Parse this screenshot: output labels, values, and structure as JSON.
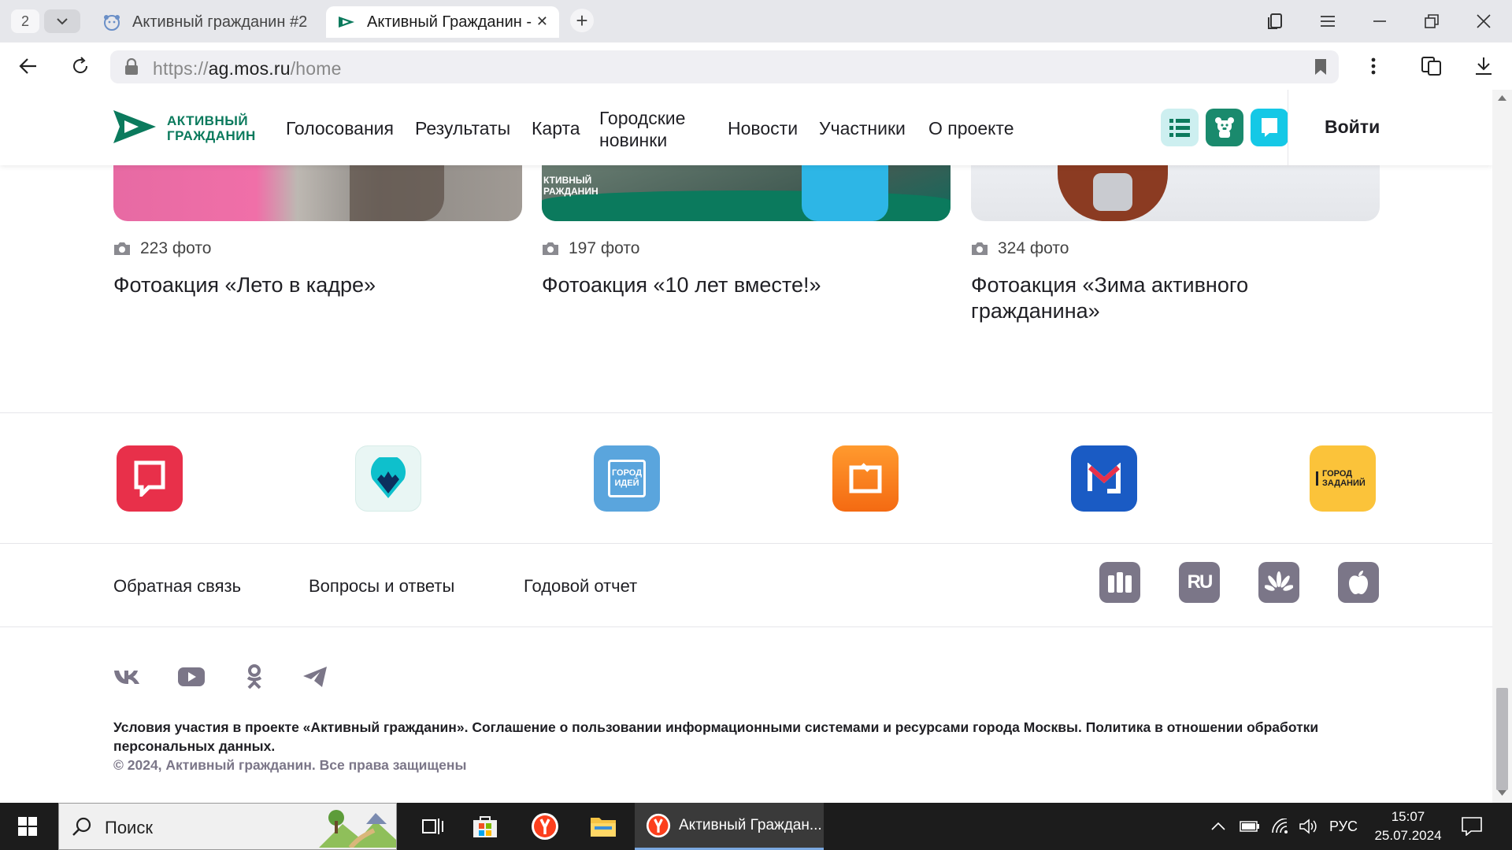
{
  "browser": {
    "tab_count": "2",
    "tabs": [
      {
        "title": "Активный гражданин #2"
      },
      {
        "title": "Активный Гражданин -"
      }
    ],
    "url_scheme": "https://",
    "url_host": "ag.mos.ru",
    "url_path": "/home"
  },
  "header": {
    "logo_line1": "АКТИВНЫЙ",
    "logo_line2": "ГРАЖДАНИН",
    "nav": [
      "Голосования",
      "Результаты",
      "Карта",
      "Городские новинки",
      "Новости",
      "Участники",
      "О проекте"
    ],
    "login": "Войти"
  },
  "photo_cards": [
    {
      "count": "223 фото",
      "title": "Фотоакция «Лето в кадре»"
    },
    {
      "count": "197 фото",
      "title": "Фотоакция «10 лет вместе!»",
      "overlay_line1": "КТИВНЫЙ",
      "overlay_line2": "РАЖДАНИН"
    },
    {
      "count": "324 фото",
      "title": "Фотоакция «Зима активного гражданина»"
    }
  ],
  "app_tiles": [
    {
      "name": "ag-app-icon",
      "color": "#e8304a"
    },
    {
      "name": "my-district-app-icon",
      "color": "#e9f6f4"
    },
    {
      "name": "gorod-idey-app-icon",
      "color": "#5aa5dd",
      "label": "ГОРОД ИДЕЙ"
    },
    {
      "name": "orange-app-icon",
      "color": "#f47a1f"
    },
    {
      "name": "moscow-metro-app-icon",
      "color": "#1a5bc4"
    },
    {
      "name": "gorod-zadaniy-app-icon",
      "color": "#fbc33a",
      "label": "ГОРОД ЗАДАНИЙ"
    }
  ],
  "footer": {
    "links": [
      "Обратная связь",
      "Вопросы и ответы",
      "Годовой отчет"
    ],
    "stores": [
      "mos-store-icon",
      "rustore-icon",
      "huawei-appgallery-icon",
      "apple-app-store-icon"
    ],
    "socials": [
      "vk-icon",
      "youtube-icon",
      "odnoklassniki-icon",
      "telegram-icon"
    ],
    "legal": "Условия участия в проекте «Активный гражданин». Соглашение о пользовании информационными системами и ресурсами города Москвы. Политика в отношении обработки персональных данных.",
    "copyright": "© 2024, Активный гражданин. Все права защищены"
  },
  "taskbar": {
    "search_placeholder": "Поиск",
    "active_window": "Активный Граждан...",
    "language": "РУС",
    "time": "15:07",
    "date": "25.07.2024"
  },
  "colors": {
    "brand_green": "#0b7a5d",
    "text_dark": "#1f1f24",
    "muted_purple": "#7b7688"
  }
}
